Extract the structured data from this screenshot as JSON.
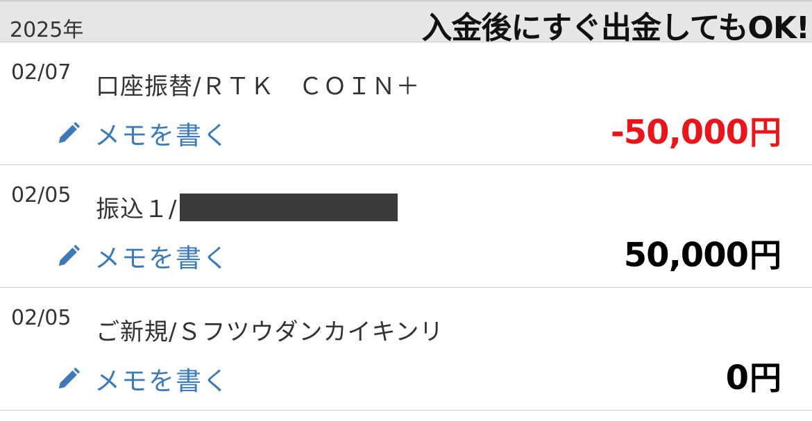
{
  "header": {
    "year": "2025年",
    "banner": "入金後にすぐ出金してもOK!"
  },
  "memo_label": "メモを書く",
  "transactions": [
    {
      "date": "02/07",
      "description": "口座振替/ＲＴＫ　ＣＯＩＮ＋",
      "amount": "-50,000",
      "unit": "円"
    },
    {
      "date": "02/05",
      "description": "振込１/",
      "amount": "50,000",
      "unit": "円"
    },
    {
      "date": "02/05",
      "description": "ご新規/Ｓフツウダンカイキンリ",
      "amount": "0",
      "unit": "円"
    }
  ],
  "colors": {
    "negative_amount": "#e8161b",
    "memo_link": "#3d7ab8",
    "header_bg": "#e6e6e6"
  },
  "icons": {
    "memo": "pencil-icon"
  }
}
